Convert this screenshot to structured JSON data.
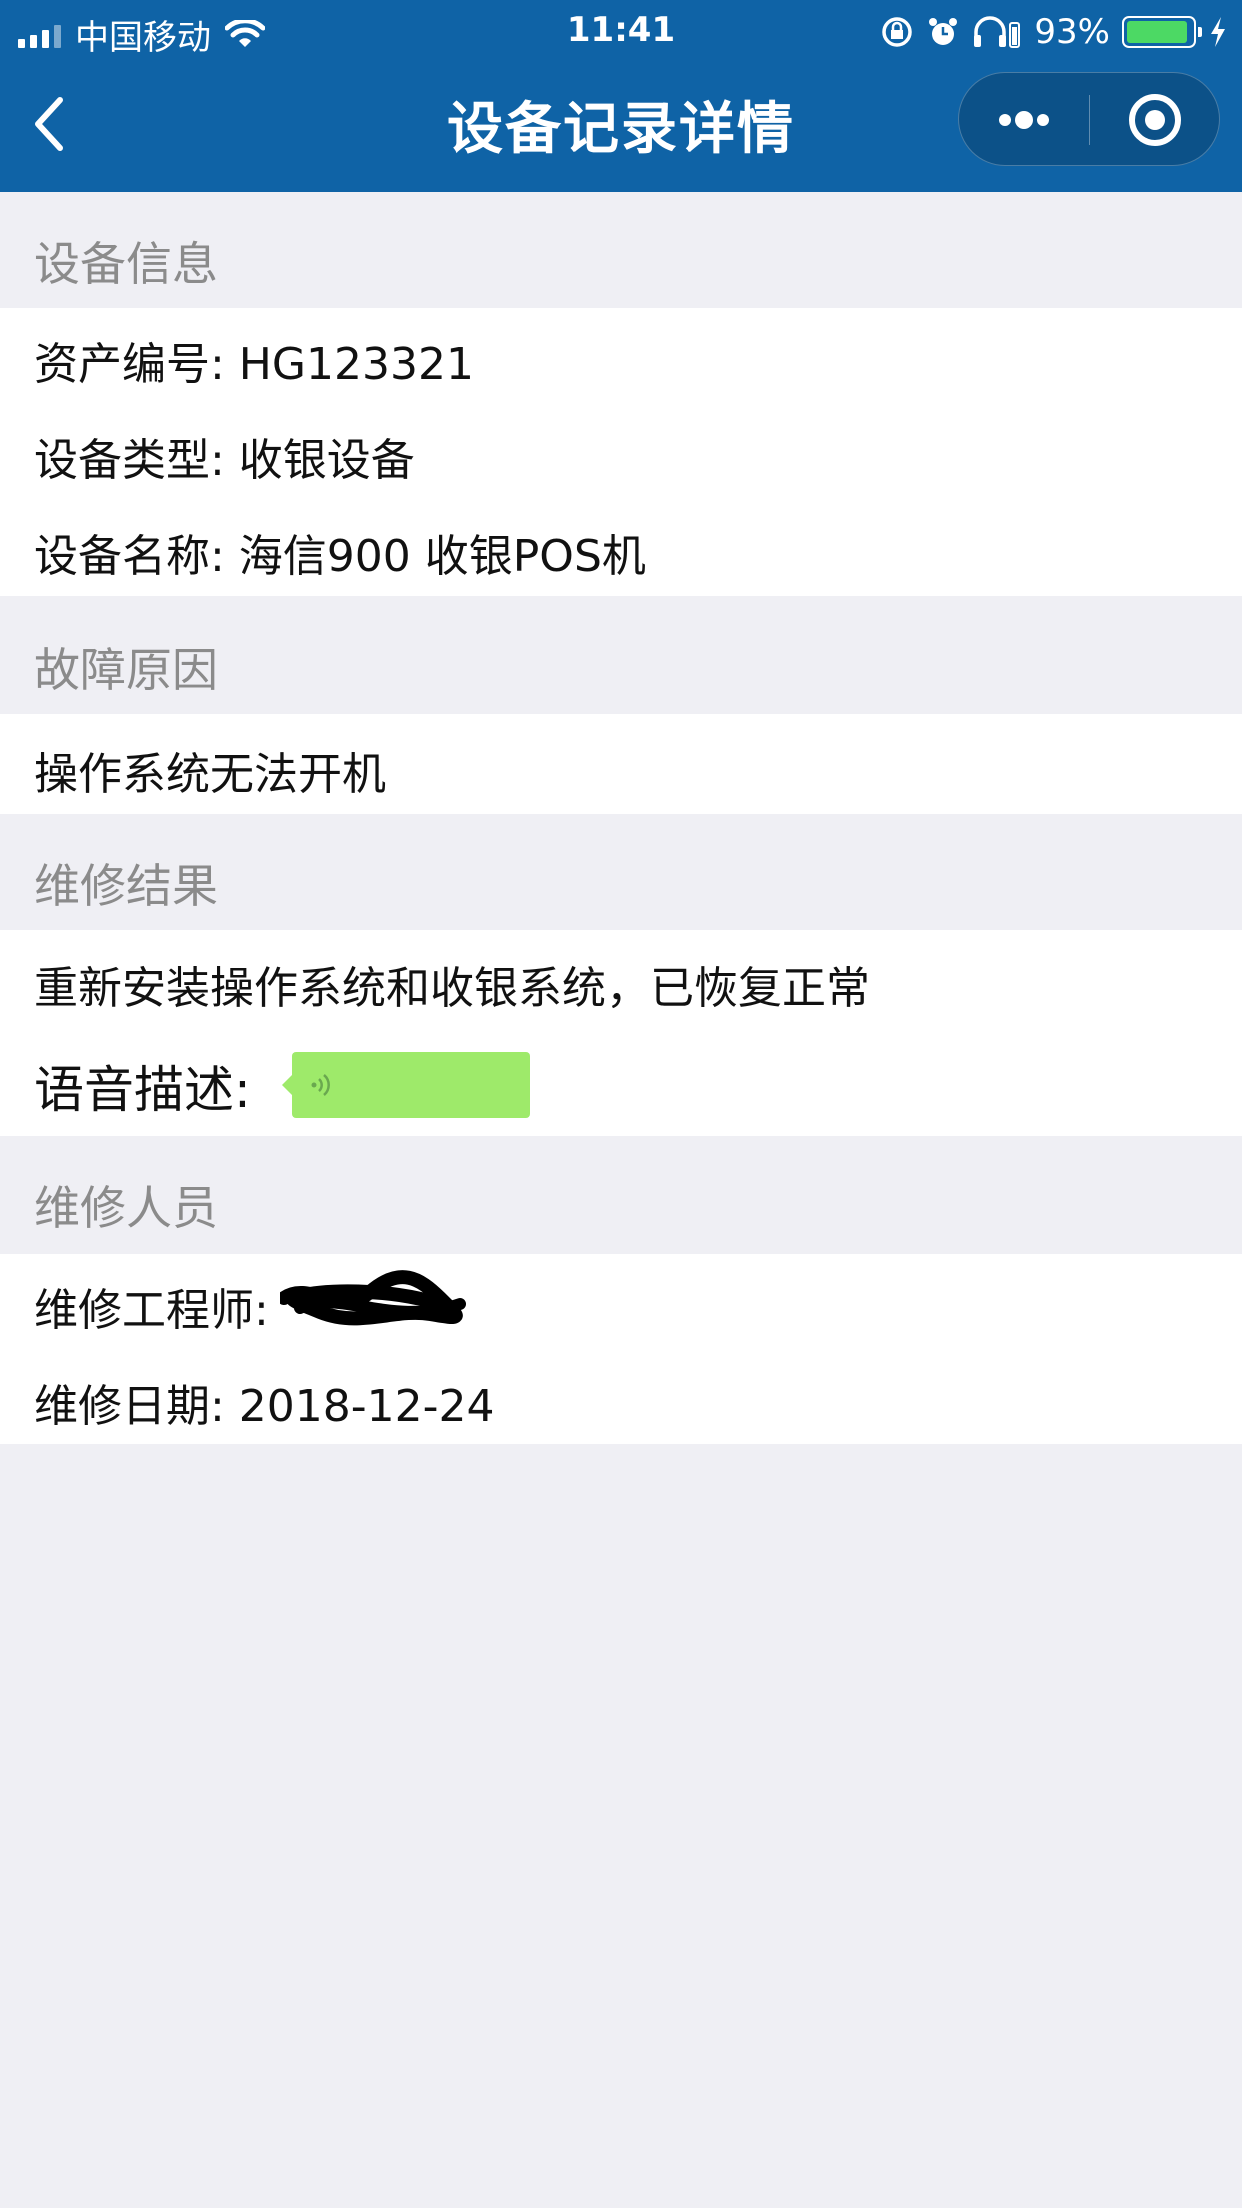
{
  "status_bar": {
    "carrier": "中国移动",
    "time": "11:41",
    "battery": "93%",
    "battery_level": 0.93
  },
  "nav": {
    "title": "设备记录详情"
  },
  "sections": {
    "device": {
      "heading": "设备信息",
      "asset_no": "资产编号: HG123321",
      "type": "设备类型: 收银设备",
      "name": "设备名称: 海信900 收银POS机"
    },
    "fault": {
      "heading": "故障原因",
      "text": "操作系统无法开机"
    },
    "result": {
      "heading": "维修结果",
      "text": "重新安装操作系统和收银系统，已恢复正常",
      "voice_label": "语音描述:"
    },
    "staff": {
      "heading": "维修人员",
      "engineer_label": "维修工程师:",
      "date": "维修日期: 2018-12-24"
    }
  },
  "colors": {
    "header": "#0f63a6",
    "page_bg": "#efeff4",
    "voice_bubble": "#9eea6a",
    "battery": "#4cd964"
  }
}
